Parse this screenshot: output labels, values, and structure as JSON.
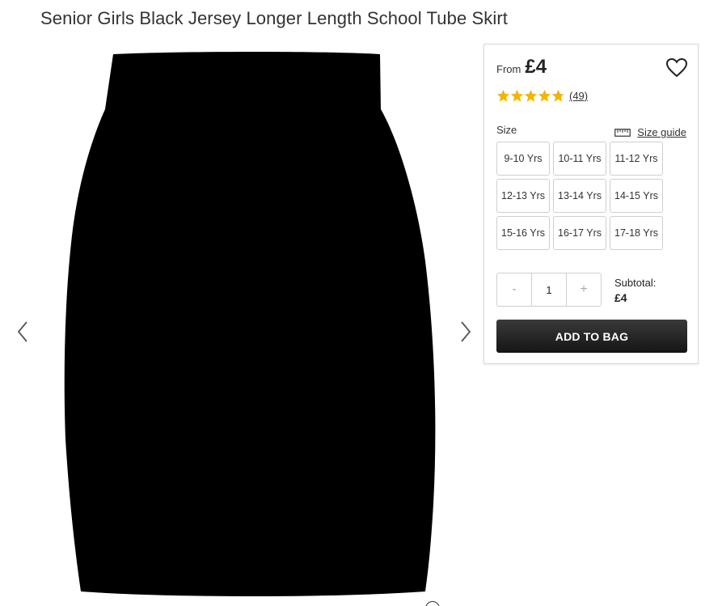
{
  "product": {
    "title": "Senior Girls Black Jersey Longer Length School Tube Skirt",
    "from_label": "From",
    "price": "£4",
    "rating": 4.8,
    "rating_color": "#f5b400",
    "review_count": "(49)"
  },
  "gallery": {
    "prev_icon": "chevron-left-icon",
    "next_icon": "chevron-right-icon",
    "image_color": "#000000"
  },
  "size": {
    "label": "Size",
    "guide_label": "Size guide",
    "options": [
      "9-10 Yrs",
      "10-11 Yrs",
      "11-12 Yrs",
      "12-13 Yrs",
      "13-14 Yrs",
      "14-15 Yrs",
      "15-16 Yrs",
      "16-17 Yrs",
      "17-18 Yrs"
    ]
  },
  "quantity": {
    "minus": "-",
    "value": "1",
    "plus": "+"
  },
  "subtotal": {
    "label": "Subtotal:",
    "amount": "£4"
  },
  "actions": {
    "add_to_bag": "ADD TO BAG",
    "button_color": "#1e1e1e"
  }
}
